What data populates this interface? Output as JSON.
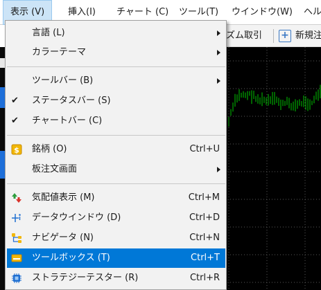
{
  "menubar": {
    "items": [
      {
        "label": "表示 (V)"
      },
      {
        "label": "挿入(I)"
      },
      {
        "label": "チャート (C)"
      },
      {
        "label": "ツール(T)"
      },
      {
        "label": "ウインドウ(W)"
      },
      {
        "label": "ヘル"
      }
    ]
  },
  "toolbar": {
    "algo_label": "ズム取引",
    "new_order_label": "新規注"
  },
  "menu": {
    "items": [
      {
        "label": "言語 (L)",
        "submenu": true
      },
      {
        "label": "カラーテーマ",
        "submenu": true
      },
      {
        "label": "ツールバー (B)",
        "submenu": true
      },
      {
        "label": "ステータスバー (S)",
        "checked": true,
        "check_mark": "✔"
      },
      {
        "label": "チャートバー (C)",
        "checked": true,
        "check_mark": "✔"
      },
      {
        "label": "銘柄 (O)",
        "shortcut": "Ctrl+U",
        "icon": "symbols-icon"
      },
      {
        "label": "板注文画面",
        "submenu": true
      },
      {
        "label": "気配値表示 (M)",
        "shortcut": "Ctrl+M",
        "icon": "market-watch-icon"
      },
      {
        "label": "データウインドウ (D)",
        "shortcut": "Ctrl+D",
        "icon": "data-window-icon"
      },
      {
        "label": "ナビゲータ (N)",
        "shortcut": "Ctrl+N",
        "icon": "navigator-icon"
      },
      {
        "label": "ツールボックス (T)",
        "shortcut": "Ctrl+T",
        "icon": "toolbox-icon",
        "highlighted": true
      },
      {
        "label": "ストラテジーテスター (R)",
        "shortcut": "Ctrl+R",
        "icon": "strategy-tester-icon"
      }
    ]
  },
  "colors": {
    "menu_highlight": "#0078d7",
    "menubar_active": "#cce4f7",
    "chart_background": "#000000",
    "candle_color": "#00c800"
  }
}
